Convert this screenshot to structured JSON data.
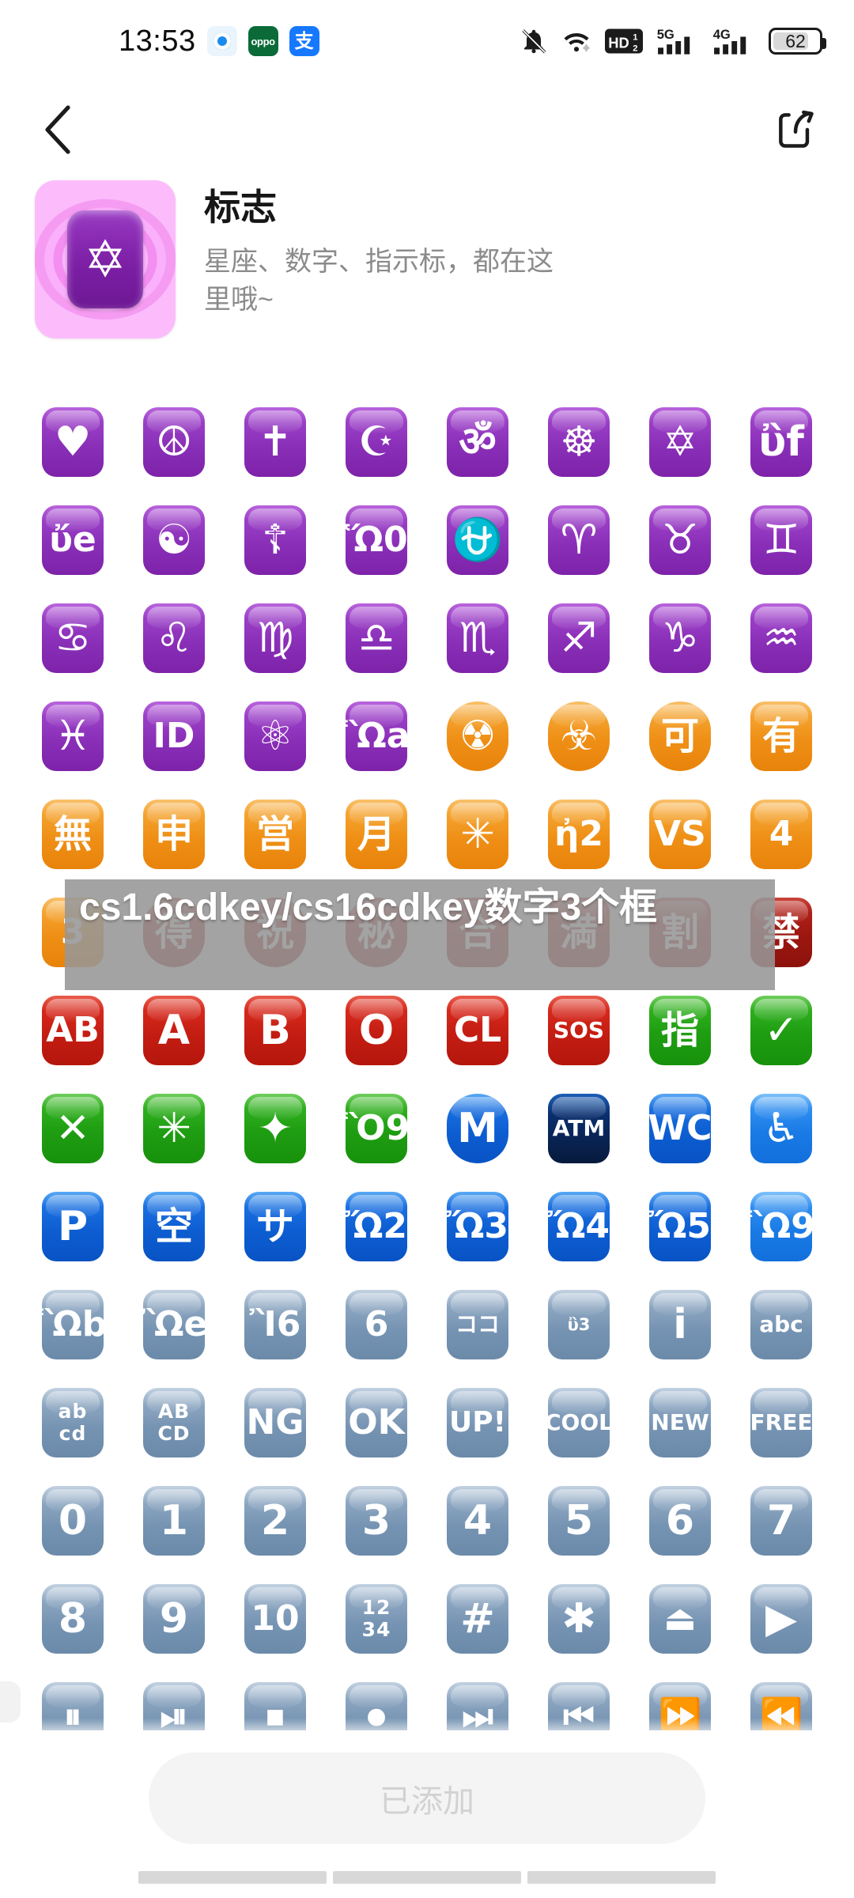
{
  "status_bar": {
    "time": "13:53",
    "app_icons": [
      "browser-icon",
      "oppo-icon",
      "alipay-icon"
    ],
    "oppo_label": "oppo",
    "alipay_label": "支",
    "right_icons": [
      "bell-muted-icon",
      "wifi-icon",
      "hd-volte-icon",
      "signal-5g-icon",
      "signal-4g-icon",
      "battery-icon"
    ],
    "volte_label": "HD",
    "volte_sim": "1/2",
    "net_5g": "5G",
    "net_4g": "4G",
    "battery_percent": "62"
  },
  "nav": {
    "back_icon": "chevron-left-icon",
    "share_icon": "share-icon"
  },
  "pack": {
    "title": "标志",
    "subtitle": "星座、数字、指示标，都在这里哦~",
    "icon_glyph": "✡",
    "icon_name": "star-of-david-pack-icon",
    "accent_color": "#f7a3f7",
    "chip_color": "#8a2bb3"
  },
  "watermark": {
    "text": "cs1.6cdkey/cs16cdkey数字3个框",
    "background_color": "#969696",
    "text_color": "#ffffff"
  },
  "bottom": {
    "add_label": "已添加",
    "add_state": "disabled",
    "nav_hint_count": 3
  },
  "grid": {
    "columns": 8,
    "rows": 14,
    "items": [
      {
        "name": "heart-decoration",
        "glyph": "♥",
        "theme": "c-purple",
        "shape": "sq",
        "size": "fs-lg"
      },
      {
        "name": "peace-symbol",
        "glyph": "☮",
        "theme": "c-purple",
        "shape": "sq",
        "size": "fs-lg"
      },
      {
        "name": "latin-cross",
        "glyph": "✝",
        "theme": "c-purple",
        "shape": "sq",
        "size": "fs-lg"
      },
      {
        "name": "star-and-crescent",
        "glyph": "☪",
        "theme": "c-purple",
        "shape": "sq",
        "size": "fs-lg"
      },
      {
        "name": "om-symbol",
        "glyph": "ॐ",
        "theme": "c-purple",
        "shape": "sq",
        "size": "fs-lg"
      },
      {
        "name": "wheel-of-dharma",
        "glyph": "☸",
        "theme": "c-purple",
        "shape": "sq",
        "size": "fs-lg"
      },
      {
        "name": "star-of-david",
        "glyph": "✡",
        "theme": "c-purple",
        "shape": "sq",
        "size": "fs-lg"
      },
      {
        "name": "dotted-six-pointed-star",
        "glyph": "ὒf",
        "theme": "c-purple",
        "shape": "sq",
        "size": "fs-lg"
      },
      {
        "name": "menorah",
        "glyph": "ὔe",
        "theme": "c-purple",
        "shape": "sq",
        "size": "fs-md"
      },
      {
        "name": "yin-yang",
        "glyph": "☯",
        "theme": "c-purple",
        "shape": "sq",
        "size": "fs-lg"
      },
      {
        "name": "orthodox-cross",
        "glyph": "☦",
        "theme": "c-purple",
        "shape": "sq",
        "size": "fs-lg"
      },
      {
        "name": "place-of-worship",
        "glyph": "Ὥ0",
        "theme": "c-purple",
        "shape": "sq",
        "size": "fs-md"
      },
      {
        "name": "ophiuchus",
        "glyph": "⛎",
        "theme": "c-purple",
        "shape": "sq",
        "size": "fs-lg"
      },
      {
        "name": "aries",
        "glyph": "♈",
        "theme": "c-purple",
        "shape": "sq",
        "size": "fs-lg"
      },
      {
        "name": "taurus",
        "glyph": "♉",
        "theme": "c-purple",
        "shape": "sq",
        "size": "fs-lg"
      },
      {
        "name": "gemini",
        "glyph": "♊",
        "theme": "c-purple",
        "shape": "sq",
        "size": "fs-lg"
      },
      {
        "name": "cancer",
        "glyph": "♋",
        "theme": "c-purple",
        "shape": "sq",
        "size": "fs-lg"
      },
      {
        "name": "leo",
        "glyph": "♌",
        "theme": "c-purple",
        "shape": "sq",
        "size": "fs-lg"
      },
      {
        "name": "virgo",
        "glyph": "♍",
        "theme": "c-purple",
        "shape": "sq",
        "size": "fs-lg"
      },
      {
        "name": "libra",
        "glyph": "♎",
        "theme": "c-purple",
        "shape": "sq",
        "size": "fs-lg"
      },
      {
        "name": "scorpio",
        "glyph": "♏",
        "theme": "c-purple",
        "shape": "sq",
        "size": "fs-lg"
      },
      {
        "name": "sagittarius",
        "glyph": "♐",
        "theme": "c-purple",
        "shape": "sq",
        "size": "fs-lg"
      },
      {
        "name": "capricorn",
        "glyph": "♑",
        "theme": "c-purple",
        "shape": "sq",
        "size": "fs-lg"
      },
      {
        "name": "aquarius",
        "glyph": "♒",
        "theme": "c-purple",
        "shape": "sq",
        "size": "fs-lg"
      },
      {
        "name": "pisces",
        "glyph": "♓",
        "theme": "c-purple",
        "shape": "sq",
        "size": "fs-lg"
      },
      {
        "name": "id-button",
        "glyph": "ID",
        "theme": "c-purple",
        "shape": "sq",
        "size": "fs-md"
      },
      {
        "name": "atom-symbol",
        "glyph": "⚛",
        "theme": "c-purple",
        "shape": "sq",
        "size": "fs-lg"
      },
      {
        "name": "womens-room",
        "glyph": "Ὣa",
        "theme": "c-purple",
        "shape": "sq",
        "size": "fs-md"
      },
      {
        "name": "radioactive",
        "glyph": "☢",
        "theme": "c-orange",
        "shape": "circ",
        "size": "fs-lg"
      },
      {
        "name": "biohazard",
        "glyph": "☣",
        "theme": "c-orange",
        "shape": "circ",
        "size": "fs-lg"
      },
      {
        "name": "japanese-acceptable-button",
        "glyph": "可",
        "theme": "c-orange",
        "shape": "circ",
        "size": "fs-cjk"
      },
      {
        "name": "japanese-reserved-button",
        "glyph": "有",
        "theme": "c-orange",
        "shape": "sq",
        "size": "fs-cjk"
      },
      {
        "name": "japanese-free-of-charge-button",
        "glyph": "無",
        "theme": "c-orange",
        "shape": "sq",
        "size": "fs-cjk"
      },
      {
        "name": "japanese-application-button",
        "glyph": "申",
        "theme": "c-orange",
        "shape": "sq",
        "size": "fs-cjk"
      },
      {
        "name": "japanese-open-for-business-button",
        "glyph": "営",
        "theme": "c-orange",
        "shape": "sq",
        "size": "fs-cjk"
      },
      {
        "name": "japanese-monthly-amount-button",
        "glyph": "月",
        "theme": "c-orange",
        "shape": "sq",
        "size": "fs-cjk"
      },
      {
        "name": "eight-pointed-star",
        "glyph": "✳",
        "theme": "c-orange",
        "shape": "sq",
        "size": "fs-lg"
      },
      {
        "name": "japanese-service-charge-button",
        "glyph": "ἠ2",
        "theme": "c-orange",
        "shape": "sq",
        "size": "fs-md"
      },
      {
        "name": "vs-button",
        "glyph": "VS",
        "theme": "c-orange",
        "shape": "sq",
        "size": "fs-md"
      },
      {
        "name": "mobile-phone-off",
        "glyph": "὏4",
        "theme": "c-orange",
        "shape": "sq",
        "size": "fs-md"
      },
      {
        "name": "vibration-mode",
        "glyph": "὏3",
        "theme": "c-orange",
        "shape": "sq",
        "size": "fs-md"
      },
      {
        "name": "japanese-bargain-button",
        "glyph": "得",
        "theme": "c-dred",
        "shape": "circ",
        "size": "fs-cjk"
      },
      {
        "name": "japanese-congratulations-button",
        "glyph": "祝",
        "theme": "c-dred",
        "shape": "circ",
        "size": "fs-cjk"
      },
      {
        "name": "japanese-secret-button",
        "glyph": "秘",
        "theme": "c-dred",
        "shape": "circ",
        "size": "fs-cjk"
      },
      {
        "name": "japanese-passing-grade-button",
        "glyph": "合",
        "theme": "c-dred",
        "shape": "sq",
        "size": "fs-cjk"
      },
      {
        "name": "japanese-no-vacancy-button",
        "glyph": "満",
        "theme": "c-dred",
        "shape": "sq",
        "size": "fs-cjk"
      },
      {
        "name": "japanese-discount-button",
        "glyph": "割",
        "theme": "c-dred",
        "shape": "sq",
        "size": "fs-cjk"
      },
      {
        "name": "japanese-prohibited-button",
        "glyph": "禁",
        "theme": "c-dred",
        "shape": "sq",
        "size": "fs-cjk"
      },
      {
        "name": "ab-button-blood-type",
        "glyph": "AB",
        "theme": "c-red",
        "shape": "sq",
        "size": "fs-md"
      },
      {
        "name": "a-button-blood-type",
        "glyph": "A",
        "theme": "c-red",
        "shape": "sq",
        "size": "fs-lg"
      },
      {
        "name": "b-button-blood-type",
        "glyph": "B",
        "theme": "c-red",
        "shape": "sq",
        "size": "fs-lg"
      },
      {
        "name": "o-button-blood-type",
        "glyph": "O",
        "theme": "c-red",
        "shape": "sq",
        "size": "fs-lg"
      },
      {
        "name": "cl-button",
        "glyph": "CL",
        "theme": "c-red",
        "shape": "sq",
        "size": "fs-md"
      },
      {
        "name": "sos-button",
        "glyph": "SOS",
        "theme": "c-red",
        "shape": "sq",
        "size": "fs-xs"
      },
      {
        "name": "japanese-reserved-finger-button",
        "glyph": "指",
        "theme": "c-green",
        "shape": "sq",
        "size": "fs-cjk"
      },
      {
        "name": "check-mark-button",
        "glyph": "✓",
        "theme": "c-green",
        "shape": "sq",
        "size": "fs-lg"
      },
      {
        "name": "cross-mark-button",
        "glyph": "✕",
        "theme": "c-green",
        "shape": "sq",
        "size": "fs-lg"
      },
      {
        "name": "eight-spoked-asterisk",
        "glyph": "✳",
        "theme": "c-green",
        "shape": "sq",
        "size": "fs-lg"
      },
      {
        "name": "sparkle",
        "glyph": "✦",
        "theme": "c-green",
        "shape": "sq",
        "size": "fs-lg"
      },
      {
        "name": "chart-increasing-with-yen",
        "glyph": "Ὃ9",
        "theme": "c-green",
        "shape": "sq",
        "size": "fs-md"
      },
      {
        "name": "circled-m",
        "glyph": "M",
        "theme": "c-blue",
        "shape": "circ",
        "size": "fs-lg"
      },
      {
        "name": "atm-sign",
        "glyph": "ATM",
        "theme": "c-navy",
        "shape": "sq",
        "size": "fs-xs"
      },
      {
        "name": "water-closet",
        "glyph": "WC",
        "theme": "c-blue",
        "shape": "sq",
        "size": "fs-md"
      },
      {
        "name": "wheelchair-symbol",
        "glyph": "♿",
        "theme": "c-blue2",
        "shape": "sq",
        "size": "fs-lg"
      },
      {
        "name": "p-button-parking",
        "glyph": "P",
        "theme": "c-blue",
        "shape": "sq",
        "size": "fs-lg"
      },
      {
        "name": "japanese-vacancy-button",
        "glyph": "空",
        "theme": "c-blue",
        "shape": "sq",
        "size": "fs-cjk"
      },
      {
        "name": "japanese-service-button",
        "glyph": "サ",
        "theme": "c-blue",
        "shape": "sq",
        "size": "fs-cjk"
      },
      {
        "name": "passport-control",
        "glyph": "Ὤ2",
        "theme": "c-blue",
        "shape": "sq",
        "size": "fs-md"
      },
      {
        "name": "customs",
        "glyph": "Ὤ3",
        "theme": "c-blue",
        "shape": "sq",
        "size": "fs-md"
      },
      {
        "name": "baggage-claim",
        "glyph": "Ὤ4",
        "theme": "c-blue",
        "shape": "sq",
        "size": "fs-md"
      },
      {
        "name": "left-luggage",
        "glyph": "Ὤ5",
        "theme": "c-blue",
        "shape": "sq",
        "size": "fs-md"
      },
      {
        "name": "mens-room",
        "glyph": "Ὣ9",
        "theme": "c-blue2",
        "shape": "sq",
        "size": "fs-md"
      },
      {
        "name": "restroom",
        "glyph": "Ὣb",
        "theme": "c-slate",
        "shape": "sq",
        "size": "fs-md"
      },
      {
        "name": "litter-in-bin-sign",
        "glyph": "Ὢe",
        "theme": "c-slate",
        "shape": "sq",
        "size": "fs-md"
      },
      {
        "name": "cinema",
        "glyph": "Ἲ6",
        "theme": "c-slate",
        "shape": "sq",
        "size": "fs-md"
      },
      {
        "name": "antenna-bars",
        "glyph": "὏6",
        "theme": "c-slate",
        "shape": "sq",
        "size": "fs-md"
      },
      {
        "name": "japanese-here-button",
        "glyph": "ココ",
        "theme": "c-slate",
        "shape": "sq",
        "size": "fs-xs"
      },
      {
        "name": "input-symbols",
        "glyph": "ὒ3",
        "theme": "c-slate",
        "shape": "sq",
        "size": "fs-xxs"
      },
      {
        "name": "information",
        "glyph": "i",
        "theme": "c-slate",
        "shape": "sq",
        "size": "fs-lg"
      },
      {
        "name": "input-latin-lowercase",
        "glyph": "abc",
        "theme": "c-slate",
        "shape": "sq",
        "size": "fs-xs"
      },
      {
        "name": "input-latin-letters",
        "glyph": "ab\ncd",
        "theme": "c-slate",
        "shape": "sq",
        "size": "two-line"
      },
      {
        "name": "input-latin-uppercase",
        "glyph": "AB\nCD",
        "theme": "c-slate",
        "shape": "sq",
        "size": "two-line"
      },
      {
        "name": "ng-button",
        "glyph": "NG",
        "theme": "c-slate",
        "shape": "sq",
        "size": "fs-md"
      },
      {
        "name": "ok-button",
        "glyph": "OK",
        "theme": "c-slate",
        "shape": "sq",
        "size": "fs-md"
      },
      {
        "name": "up-button",
        "glyph": "UP!",
        "theme": "c-slate",
        "shape": "sq",
        "size": "fs-sm"
      },
      {
        "name": "cool-button",
        "glyph": "COOL",
        "theme": "c-slate",
        "shape": "sq",
        "size": "fs-xs"
      },
      {
        "name": "new-button",
        "glyph": "NEW",
        "theme": "c-slate",
        "shape": "sq",
        "size": "fs-xs"
      },
      {
        "name": "free-button",
        "glyph": "FREE",
        "theme": "c-slate",
        "shape": "sq",
        "size": "fs-xs"
      },
      {
        "name": "keycap-0",
        "glyph": "0",
        "theme": "c-slate",
        "shape": "sq",
        "size": "fs-lg"
      },
      {
        "name": "keycap-1",
        "glyph": "1",
        "theme": "c-slate",
        "shape": "sq",
        "size": "fs-lg"
      },
      {
        "name": "keycap-2",
        "glyph": "2",
        "theme": "c-slate",
        "shape": "sq",
        "size": "fs-lg"
      },
      {
        "name": "keycap-3",
        "glyph": "3",
        "theme": "c-slate",
        "shape": "sq",
        "size": "fs-lg"
      },
      {
        "name": "keycap-4",
        "glyph": "4",
        "theme": "c-slate",
        "shape": "sq",
        "size": "fs-lg"
      },
      {
        "name": "keycap-5",
        "glyph": "5",
        "theme": "c-slate",
        "shape": "sq",
        "size": "fs-lg"
      },
      {
        "name": "keycap-6",
        "glyph": "6",
        "theme": "c-slate",
        "shape": "sq",
        "size": "fs-lg"
      },
      {
        "name": "keycap-7",
        "glyph": "7",
        "theme": "c-slate",
        "shape": "sq",
        "size": "fs-lg"
      },
      {
        "name": "keycap-8",
        "glyph": "8",
        "theme": "c-slate",
        "shape": "sq",
        "size": "fs-lg"
      },
      {
        "name": "keycap-9",
        "glyph": "9",
        "theme": "c-slate",
        "shape": "sq",
        "size": "fs-lg"
      },
      {
        "name": "keycap-10",
        "glyph": "10",
        "theme": "c-slate",
        "shape": "sq",
        "size": "fs-md"
      },
      {
        "name": "input-numbers",
        "glyph": "12\n34",
        "theme": "c-slate",
        "shape": "sq",
        "size": "two-line"
      },
      {
        "name": "keycap-hash",
        "glyph": "#",
        "theme": "c-slate",
        "shape": "sq",
        "size": "fs-lg"
      },
      {
        "name": "keycap-asterisk",
        "glyph": "✱",
        "theme": "c-slate",
        "shape": "sq",
        "size": "fs-lg"
      },
      {
        "name": "eject-button",
        "glyph": "⏏",
        "theme": "c-slate",
        "shape": "sq",
        "size": "fs-md"
      },
      {
        "name": "play-button",
        "glyph": "▶",
        "theme": "c-slate",
        "shape": "sq",
        "size": "fs-lg"
      },
      {
        "name": "pause-button",
        "glyph": "⏸",
        "theme": "c-slate",
        "shape": "sq",
        "size": "fs-md"
      },
      {
        "name": "play-or-pause-button",
        "glyph": "⏯",
        "theme": "c-slate",
        "shape": "sq",
        "size": "fs-md"
      },
      {
        "name": "stop-button",
        "glyph": "⏹",
        "theme": "c-slate",
        "shape": "sq",
        "size": "fs-md"
      },
      {
        "name": "record-button",
        "glyph": "⏺",
        "theme": "c-slate",
        "shape": "sq",
        "size": "fs-md"
      },
      {
        "name": "next-track-button",
        "glyph": "⏭",
        "theme": "c-slate",
        "shape": "sq",
        "size": "fs-md"
      },
      {
        "name": "last-track-button",
        "glyph": "⏮",
        "theme": "c-slate",
        "shape": "sq",
        "size": "fs-md"
      },
      {
        "name": "fast-forward-button",
        "glyph": "⏩",
        "theme": "c-slate",
        "shape": "sq",
        "size": "fs-md"
      },
      {
        "name": "fast-reverse-button",
        "glyph": "⏪",
        "theme": "c-slate",
        "shape": "sq",
        "size": "fs-md"
      }
    ]
  }
}
